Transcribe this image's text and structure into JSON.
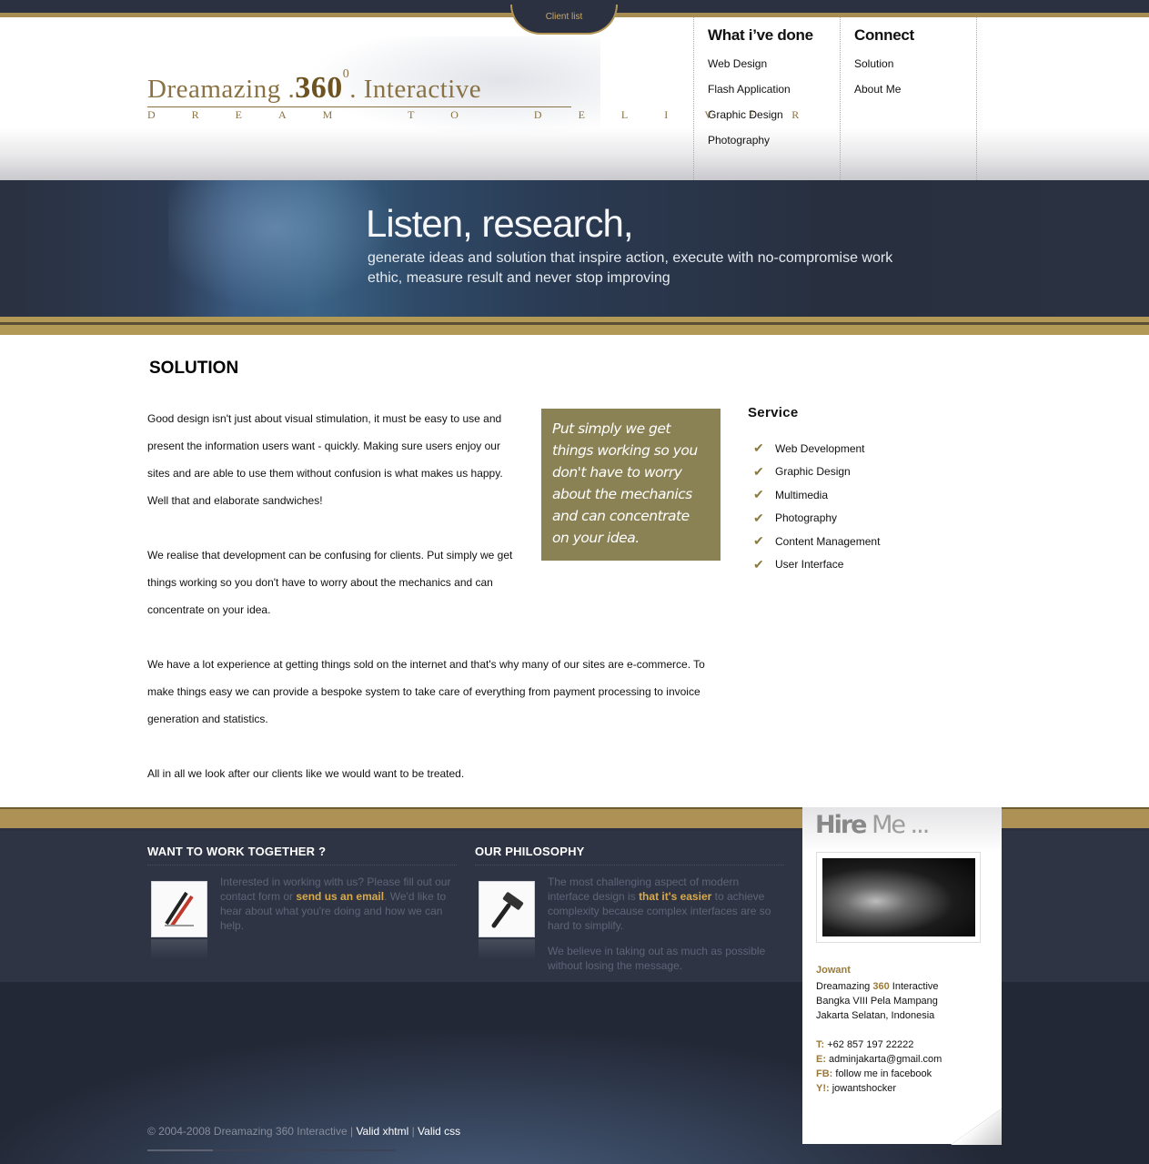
{
  "header": {
    "client_tab": "Client list",
    "logo": {
      "word1": "Dreamazing",
      "num": "360",
      "degree": "0",
      "word2": "Interactive",
      "tagline": "DREAM TO DELIVER"
    },
    "nav": {
      "done_title": "What i’ve done",
      "done_items": [
        "Web Design",
        "Flash Application",
        "Graphic Design",
        "Photography"
      ],
      "connect_title": "Connect",
      "connect_items": [
        "Solution",
        "About Me"
      ]
    }
  },
  "banner": {
    "headline": "Listen, research,",
    "subline": "generate ideas and solution that inspire action, execute with no-compromise work ethic, measure result and never stop improving"
  },
  "content": {
    "title": "SOLUTION",
    "paragraphs": [
      "Good design isn't just about visual stimulation, it must be easy to use and present the information users want - quickly. Making sure users enjoy our sites and are able to use them without confusion is what makes us happy. Well that and elaborate sandwiches!",
      "We realise that development can be confusing for clients. Put simply we get things working so you don't have to worry about the mechanics and can concentrate on your idea.",
      "We have a lot experience at getting things sold on the internet and that's why many of our sites are e-commerce. To make things easy we can provide a bespoke system to take care of everything from payment processing to invoice generation and statistics.",
      "All in all we look after our clients like we would want to be treated."
    ],
    "quote": "Put simply we get things working so you don't have to worry about the mechanics and can concentrate on your idea.",
    "service_title": "Service",
    "services": [
      "Web Development",
      "Graphic Design",
      "Multimedia",
      "Photography",
      "Content Management",
      "User Interface"
    ]
  },
  "footer": {
    "work_title": "WANT TO WORK TOGETHER ?",
    "work_text_pre": "Interested in working with us? Please fill out our contact form or ",
    "work_link": "send us an email",
    "work_text_post": ". We'd like to hear about what you're doing and how we can help.",
    "phil_title": "OUR PHILOSOPHY",
    "phil_text_pre": "The most challenging aspect of modern interface design is ",
    "phil_hl": "that it's easier",
    "phil_text_post": " to achieve complexity because complex interfaces are so hard to simplify.",
    "phil_text2": "We believe in taking out as much as possible without losing the message.",
    "copyright": "© 2004-2008 Dreamazing 360 Interactive | ",
    "valid_xhtml": "Valid xhtml",
    "sep": " | ",
    "valid_css": "Valid css"
  },
  "hire": {
    "title_bold": "Hire",
    "title_rest": " Me ...",
    "name": "Jowant",
    "company_pre": "Dreamazing ",
    "company_num": "360",
    "company_post": " Interactive",
    "address1": "Bangka VIII Pela Mampang",
    "address2": "Jakarta Selatan, Indonesia",
    "t_key": "T:",
    "t_val": " +62 857 197 22222",
    "e_key": "E:",
    "e_val": " adminjakarta@gmail.com",
    "fb_key": "FB:",
    "fb_val": " follow me in facebook",
    "y_key": "Y!:",
    "y_val": " jowantshocker"
  },
  "colors": {
    "gold": "#b39956",
    "navy": "#2b3140",
    "quote_bg": "#8a8154",
    "accent_text": "#9a7a3a",
    "highlight": "#d9a94a"
  },
  "icons": {
    "service_check": "check-icon",
    "work_icon": "pencil-icon",
    "phil_icon": "hammer-icon"
  }
}
